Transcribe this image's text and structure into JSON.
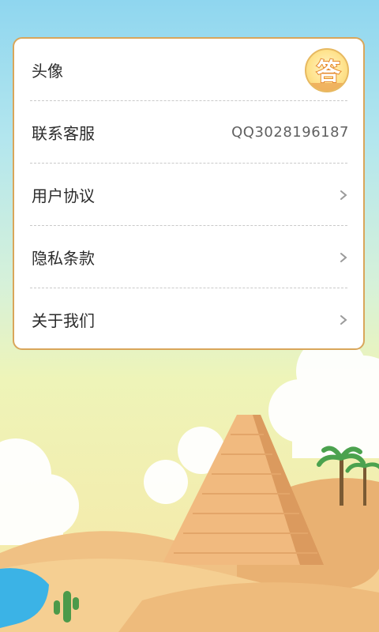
{
  "settings": {
    "rows": [
      {
        "label": "头像"
      },
      {
        "label": "联系客服",
        "value": "QQ3028196187"
      },
      {
        "label": "用户协议"
      },
      {
        "label": "隐私条款"
      },
      {
        "label": "关于我们"
      }
    ]
  },
  "avatar": {
    "glyph": "答"
  },
  "icons": {
    "chevron": "chevron-right-icon",
    "avatar": "app-logo-avatar"
  },
  "colors": {
    "card_border": "#d9a65a",
    "divider": "#c9c9c9",
    "text": "#2b2b2b",
    "value_text": "#606060"
  }
}
